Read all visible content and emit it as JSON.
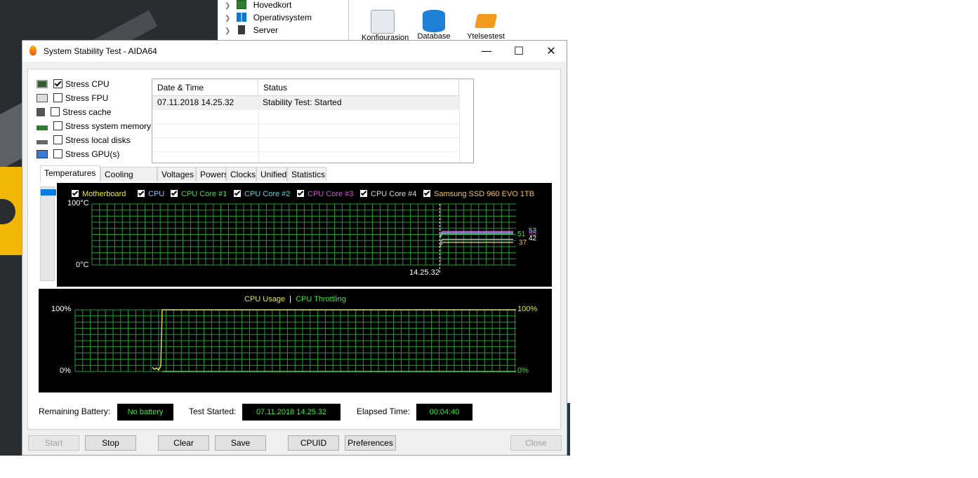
{
  "background_app": {
    "tree": [
      {
        "label": "Hovedkort",
        "icon": "motherboard-icon"
      },
      {
        "label": "Operativsystem",
        "icon": "windows-icon"
      },
      {
        "label": "Server",
        "icon": "server-icon"
      }
    ],
    "toolbar": [
      {
        "label": "Konfigurasjon",
        "icon": "config-icon"
      },
      {
        "label": "Database",
        "icon": "database-icon"
      },
      {
        "label": "Ytelsestest",
        "icon": "benchmark-icon"
      }
    ]
  },
  "window": {
    "title": "System Stability Test - AIDA64",
    "controls": {
      "minimize": "—",
      "maximize": "☐",
      "close": "✕"
    }
  },
  "stress_options": [
    {
      "label": "Stress CPU",
      "checked": true,
      "icon": "cpu-chip-icon"
    },
    {
      "label": "Stress FPU",
      "checked": false,
      "icon": "fpu-icon"
    },
    {
      "label": "Stress cache",
      "checked": false,
      "icon": "cache-icon"
    },
    {
      "label": "Stress system memory",
      "checked": false,
      "icon": "memory-icon"
    },
    {
      "label": "Stress local disks",
      "checked": false,
      "icon": "disk-icon"
    },
    {
      "label": "Stress GPU(s)",
      "checked": false,
      "icon": "gpu-icon"
    }
  ],
  "log": {
    "columns": [
      "Date & Time",
      "Status"
    ],
    "rows": [
      {
        "datetime": "07.11.2018 14.25.32",
        "status": "Stability Test: Started"
      }
    ]
  },
  "tabs": [
    "Temperatures",
    "Cooling Fans",
    "Voltages",
    "Powers",
    "Clocks",
    "Unified",
    "Statistics"
  ],
  "active_tab": "Temperatures",
  "temp_legend": [
    {
      "label": "Motherboard",
      "color": "#e6e64a"
    },
    {
      "label": "CPU",
      "color": "#8ec8ff"
    },
    {
      "label": "CPU Core #1",
      "color": "#43e043"
    },
    {
      "label": "CPU Core #2",
      "color": "#4ad8e6"
    },
    {
      "label": "CPU Core #3",
      "color": "#e04ae0"
    },
    {
      "label": "CPU Core #4",
      "color": "#d8d8d8"
    },
    {
      "label": "Samsung SSD 960 EVO 1TB",
      "color": "#f0c060"
    }
  ],
  "temp_graph": {
    "y_max_label": "100°C",
    "y_min_label": "0°C",
    "time_label": "14.25.32",
    "value_labels": [
      {
        "text": "51",
        "color": "#43e043"
      },
      {
        "text": "53",
        "color": "#8ec8ff"
      },
      {
        "text": "55",
        "color": "#e04ae0"
      },
      {
        "text": "42",
        "color": "#ffffff"
      },
      {
        "text": "37",
        "color": "#f0c060"
      }
    ],
    "start_fraction": 0.82,
    "values": {
      "Motherboard": 37,
      "CPU": 53,
      "CPU Core #1": 51,
      "CPU Core #2": 55,
      "CPU Core #3": 55,
      "CPU Core #4": 42,
      "Samsung SSD 960 EVO 1TB": 37
    }
  },
  "usage_graph": {
    "title_usage": "CPU Usage",
    "separator": "|",
    "title_throttle": "CPU Throttling",
    "left_max": "100%",
    "left_min": "0%",
    "right_max": "100%",
    "right_min": "0%",
    "usage_percent": 100,
    "throttling_percent": 0
  },
  "status": {
    "battery_label": "Remaining Battery:",
    "battery_value": "No battery",
    "started_label": "Test Started:",
    "started_value": "07.11.2018 14.25.32",
    "elapsed_label": "Elapsed Time:",
    "elapsed_value": "00:04:40"
  },
  "buttons": {
    "start": "Start",
    "stop": "Stop",
    "clear": "Clear",
    "save": "Save",
    "cpuid": "CPUID",
    "preferences": "Preferences",
    "close": "Close"
  }
}
